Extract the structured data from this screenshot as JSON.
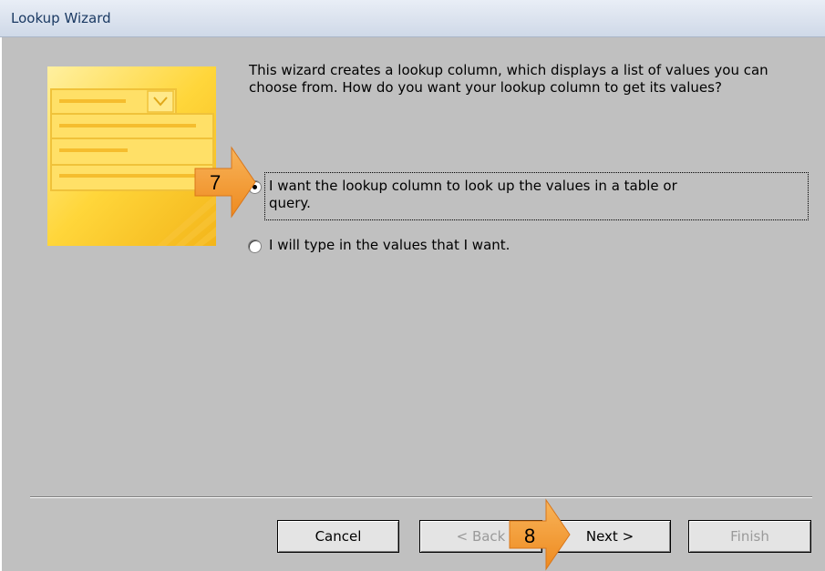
{
  "window": {
    "title": "Lookup Wizard"
  },
  "intro": {
    "text": "This wizard creates a lookup column, which displays a list of values you can choose from.  How do you want your lookup column to get its values?"
  },
  "options": [
    {
      "label_line1": "I want the lookup column to look up the values in a table or",
      "label_line2": "query.",
      "checked": true
    },
    {
      "label": "I will type in the values that I want.",
      "checked": false
    }
  ],
  "buttons": {
    "cancel": "Cancel",
    "back": "< Back",
    "next": "Next >",
    "finish": "Finish"
  },
  "callouts": {
    "step7": "7",
    "step8": "8"
  },
  "colors": {
    "dialog_bg": "#c0c0c0",
    "callout": "#f5a033",
    "illustration": "#ffd23a"
  }
}
